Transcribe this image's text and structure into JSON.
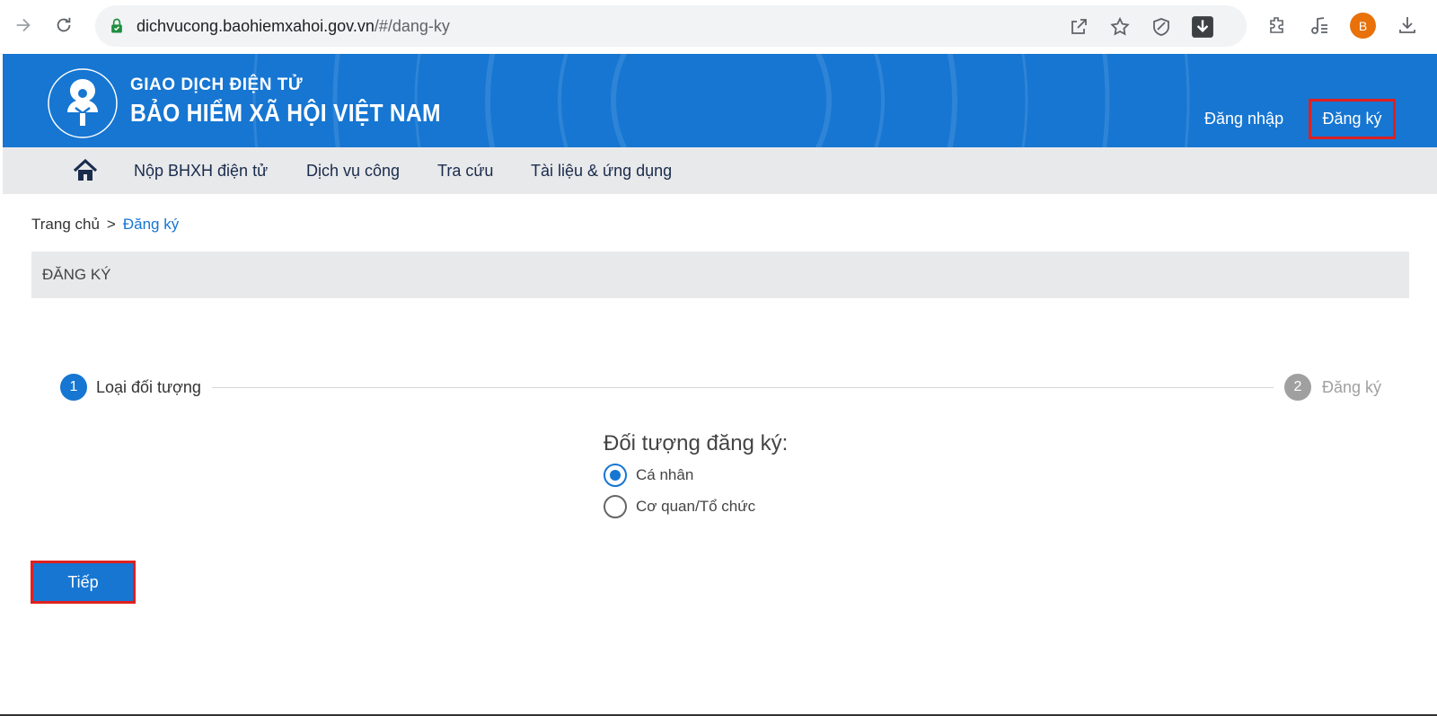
{
  "browser": {
    "url_host": "dichvucong.baohiemxahoi.gov.vn",
    "url_path": "/#/dang-ky",
    "profile_initial": "B",
    "icons": [
      "forward-icon",
      "reload-icon",
      "lock-icon",
      "share-icon",
      "star-icon",
      "shield-icon",
      "download-arrow-icon",
      "extensions-icon",
      "media-icon",
      "downloads-icon"
    ]
  },
  "header": {
    "brand_sub": "GIAO DỊCH ĐIỆN TỬ",
    "brand_main": "BẢO HIỂM XÃ HỘI VIỆT NAM",
    "login": "Đăng nhập",
    "register": "Đăng ký"
  },
  "menu": {
    "items": [
      "Nộp BHXH điện tử",
      "Dịch vụ công",
      "Tra cứu",
      "Tài liệu & ứng dụng"
    ]
  },
  "breadcrumb": {
    "home": "Trang chủ",
    "separator": ">",
    "current": "Đăng ký"
  },
  "panel": {
    "title": "ĐĂNG KÝ"
  },
  "steps": [
    {
      "number": "1",
      "label": "Loại đối tượng",
      "active": true
    },
    {
      "number": "2",
      "label": "Đăng ký",
      "active": false
    }
  ],
  "form": {
    "question": "Đối tượng đăng ký:",
    "options": [
      {
        "label": "Cá nhân",
        "checked": true
      },
      {
        "label": "Cơ quan/Tổ chức",
        "checked": false
      }
    ],
    "next": "Tiếp"
  },
  "colors": {
    "brand_blue": "#1676d2",
    "highlight_red": "#e02020",
    "inactive_step": "#a0a0a0"
  }
}
